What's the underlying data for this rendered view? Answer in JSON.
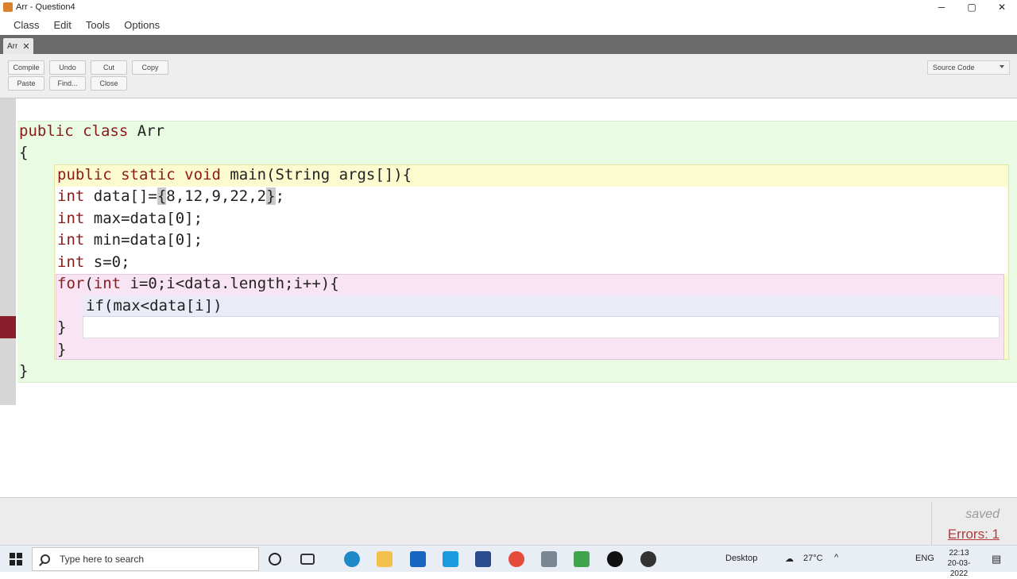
{
  "window": {
    "title": "Arr - Question4",
    "controls": {
      "minimize": "─",
      "maximize": "▢",
      "close": "✕"
    }
  },
  "menu": [
    "Class",
    "Edit",
    "Tools",
    "Options"
  ],
  "tab": {
    "label": "Arr",
    "close": "✕"
  },
  "toolbar": {
    "buttons": [
      "Compile",
      "Undo",
      "Cut",
      "Copy",
      "Paste",
      "Find...",
      "Close"
    ],
    "view_select": "Source Code"
  },
  "code": {
    "l1_kw": "public class",
    "l1_rest": " Arr",
    "l2": "{",
    "l3_kw": "public static void",
    "l3_rest": " main(String args[]){",
    "l4_kw": "int",
    "l4_a": " data[]=",
    "l4_b": "{",
    "l4_c": "8,12,9,22,2",
    "l4_d": "}",
    "l4_e": ";",
    "l5_kw": "int",
    "l5_rest": " max=data[0];",
    "l6_kw": "int",
    "l6_rest": " min=data[0];",
    "l7_kw": "int",
    "l7_rest": " s=0;",
    "l8_kw1": "for",
    "l8_a": "(",
    "l8_kw2": "int",
    "l8_rest": " i=0;i<data.length;i++){",
    "l9": "if(max<data[i])",
    "l10": "}",
    "l11": "}",
    "l12": "}"
  },
  "status": {
    "saved": "saved",
    "errors": "Errors: 1"
  },
  "taskbar": {
    "search_placeholder": "Type here to search",
    "desktop": "Desktop",
    "weather": "27°C",
    "lang": "ENG",
    "time": "22:13",
    "date": "20-03-2022"
  },
  "colors": {
    "keyword": "#8b1a1a",
    "class_scope": "#eafbe4",
    "method_scope": "#fbfbcf",
    "loop_scope": "#f8e4f3",
    "error_mark": "#8a1f2c",
    "errors_link": "#b23c3c"
  }
}
